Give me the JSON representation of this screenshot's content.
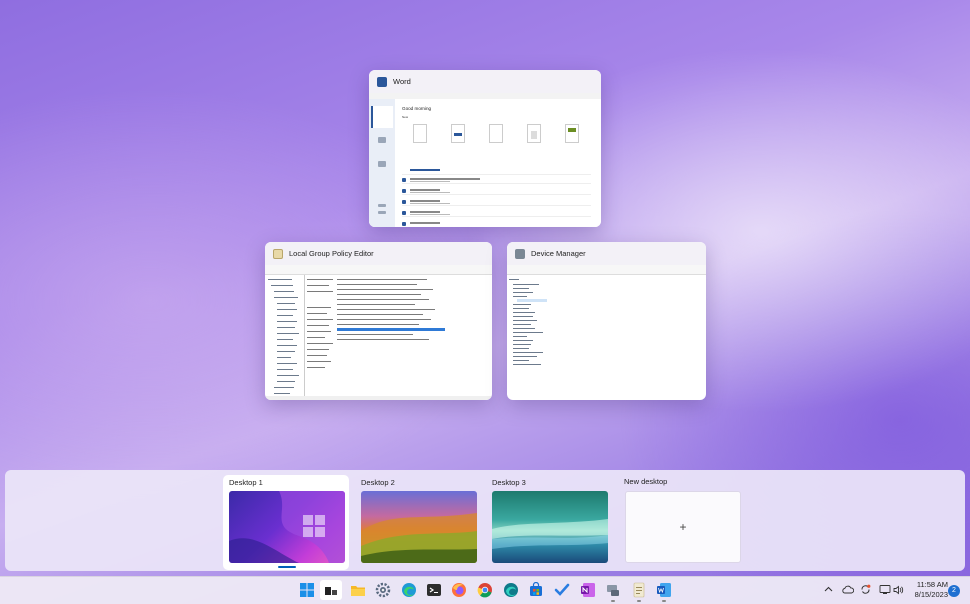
{
  "task_view": {
    "windows": [
      {
        "title": "Word",
        "app": "word"
      },
      {
        "title": "Local Group Policy Editor",
        "app": "gpedit"
      },
      {
        "title": "Device Manager",
        "app": "devmgmt"
      }
    ],
    "word_preview": {
      "greeting": "Good morning",
      "section": "New"
    }
  },
  "desktops": {
    "items": [
      {
        "label": "Desktop 1",
        "active": true
      },
      {
        "label": "Desktop 2",
        "active": false
      },
      {
        "label": "Desktop 3",
        "active": false
      }
    ],
    "new_desktop_label": "New desktop",
    "new_desktop_icon": "+"
  },
  "taskbar": {
    "apps": [
      "start",
      "task-view",
      "file-explorer",
      "settings",
      "edge",
      "terminal",
      "firefox",
      "chrome",
      "edge-dev",
      "store",
      "todo",
      "onenote",
      "device-manager",
      "notepad",
      "word"
    ],
    "tray_icons": [
      "chevron-up",
      "onedrive",
      "sync",
      "network",
      "volume"
    ],
    "time": "11:58 AM",
    "date": "8/15/2023",
    "notification_count": "2"
  },
  "colors": {
    "word": "#2b579a",
    "accent": "#005fb8"
  }
}
